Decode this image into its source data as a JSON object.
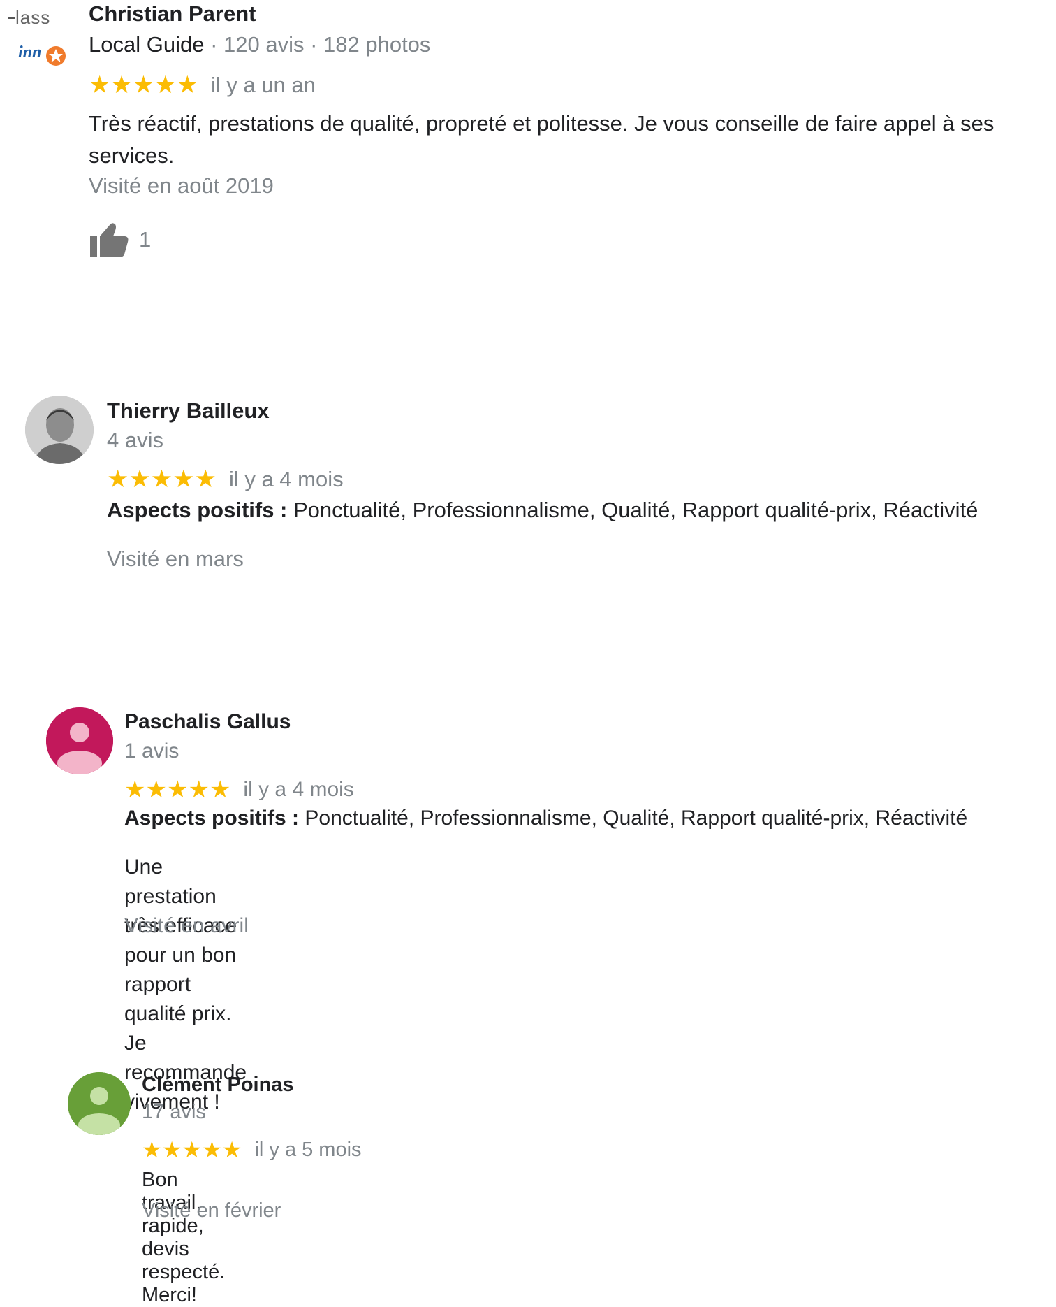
{
  "colors": {
    "star": "#fbbc04",
    "name_text": "#202124",
    "secondary_text": "#80868b",
    "avatar_pink": "#c2185b",
    "avatar_green": "#689f38"
  },
  "reviews": [
    {
      "name": "Christian Parent",
      "guide": "Local Guide",
      "stats": " · 120 avis · 182 photos",
      "rating": 5,
      "ago": "il y a un an",
      "text": "Très réactif, prestations de qualité, propreté et politesse. Je vous conseille de faire appel à ses services.",
      "visited": "Visité en août 2019",
      "likes": "1",
      "avatar_icon": "class-inno-logo-icon"
    },
    {
      "name": "Thierry Bailleux",
      "stats": "4 avis",
      "rating": 5,
      "ago": "il y a 4 mois",
      "aspects_label": "Aspects positifs :",
      "aspects": " Ponctualité, Professionnalisme, Qualité, Rapport qualité-prix, Réactivité",
      "visited": "Visité en mars",
      "avatar_icon": "profile-photo-icon"
    },
    {
      "name": "Paschalis Gallus",
      "stats": "1 avis",
      "rating": 5,
      "ago": "il y a 4 mois",
      "aspects_label": "Aspects positifs :",
      "aspects": " Ponctualité, Professionnalisme, Qualité, Rapport qualité-prix, Réactivité",
      "text_line1": "Une prestation très efficace pour un bon rapport qualité prix.",
      "text_line2": "Je recommande vivement !",
      "visited": "Visité en avril",
      "avatar_icon": "default-person-icon"
    },
    {
      "name": "Clément Poinas",
      "stats": "17 avis",
      "rating": 5,
      "ago": "il y a 5 mois",
      "text": "Bon travail, rapide, devis respecté. Merci!",
      "visited": "Visité en février",
      "avatar_icon": "default-person-icon"
    }
  ]
}
